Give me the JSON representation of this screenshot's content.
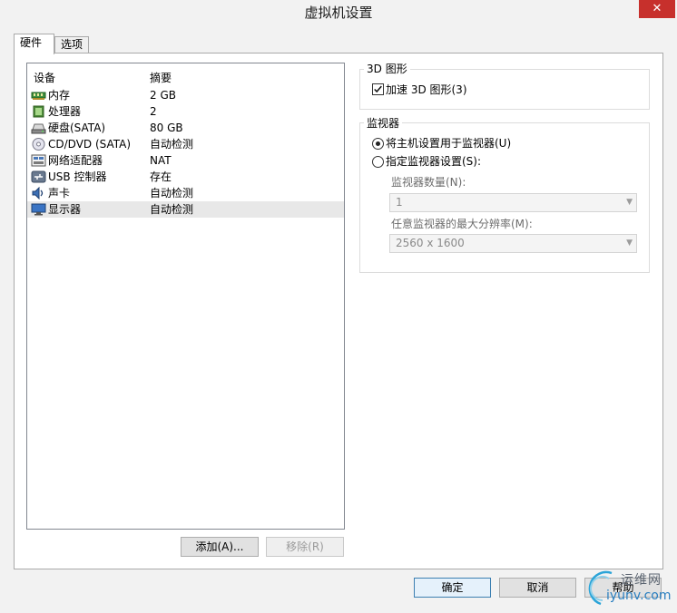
{
  "window": {
    "title": "虚拟机设置",
    "close_glyph": "✕"
  },
  "tabs": [
    {
      "label": "硬件",
      "active": true
    },
    {
      "label": "选项",
      "active": false
    }
  ],
  "device_list": {
    "columns": [
      "设备",
      "摘要"
    ],
    "rows": [
      {
        "name": "内存",
        "summary": "2 GB",
        "icon": "memory-icon"
      },
      {
        "name": "处理器",
        "summary": "2",
        "icon": "processor-icon"
      },
      {
        "name": "硬盘(SATA)",
        "summary": "80 GB",
        "icon": "hard-disk-icon"
      },
      {
        "name": "CD/DVD (SATA)",
        "summary": "自动检测",
        "icon": "cd-dvd-icon"
      },
      {
        "name": "网络适配器",
        "summary": "NAT",
        "icon": "network-adapter-icon"
      },
      {
        "name": "USB 控制器",
        "summary": "存在",
        "icon": "usb-icon"
      },
      {
        "name": "声卡",
        "summary": "自动检测",
        "icon": "sound-card-icon"
      },
      {
        "name": "显示器",
        "summary": "自动检测",
        "icon": "display-icon",
        "selected": true
      }
    ]
  },
  "buttons": {
    "add": "添加(A)...",
    "remove": "移除(R)",
    "ok": "确定",
    "cancel": "取消",
    "help": "帮助"
  },
  "graphics3d": {
    "title": "3D 图形",
    "accelerate_label": "加速 3D 图形(3)",
    "accelerate_checked": true
  },
  "monitors": {
    "title": "监视器",
    "use_host_label": "将主机设置用于监视器(U)",
    "use_host_selected": true,
    "specify_label": "指定监视器设置(S):",
    "count_label": "监视器数量(N):",
    "count_value": "1",
    "max_res_label": "任意监视器的最大分辨率(M):",
    "max_res_value": "2560 x 1600"
  },
  "watermark": {
    "text_cn": "运维网",
    "text_en": "iyunv.com"
  },
  "colors": {
    "close": "#c7302c",
    "selected_row": "#e8e8e8",
    "primary_border": "#3c7fb1"
  }
}
